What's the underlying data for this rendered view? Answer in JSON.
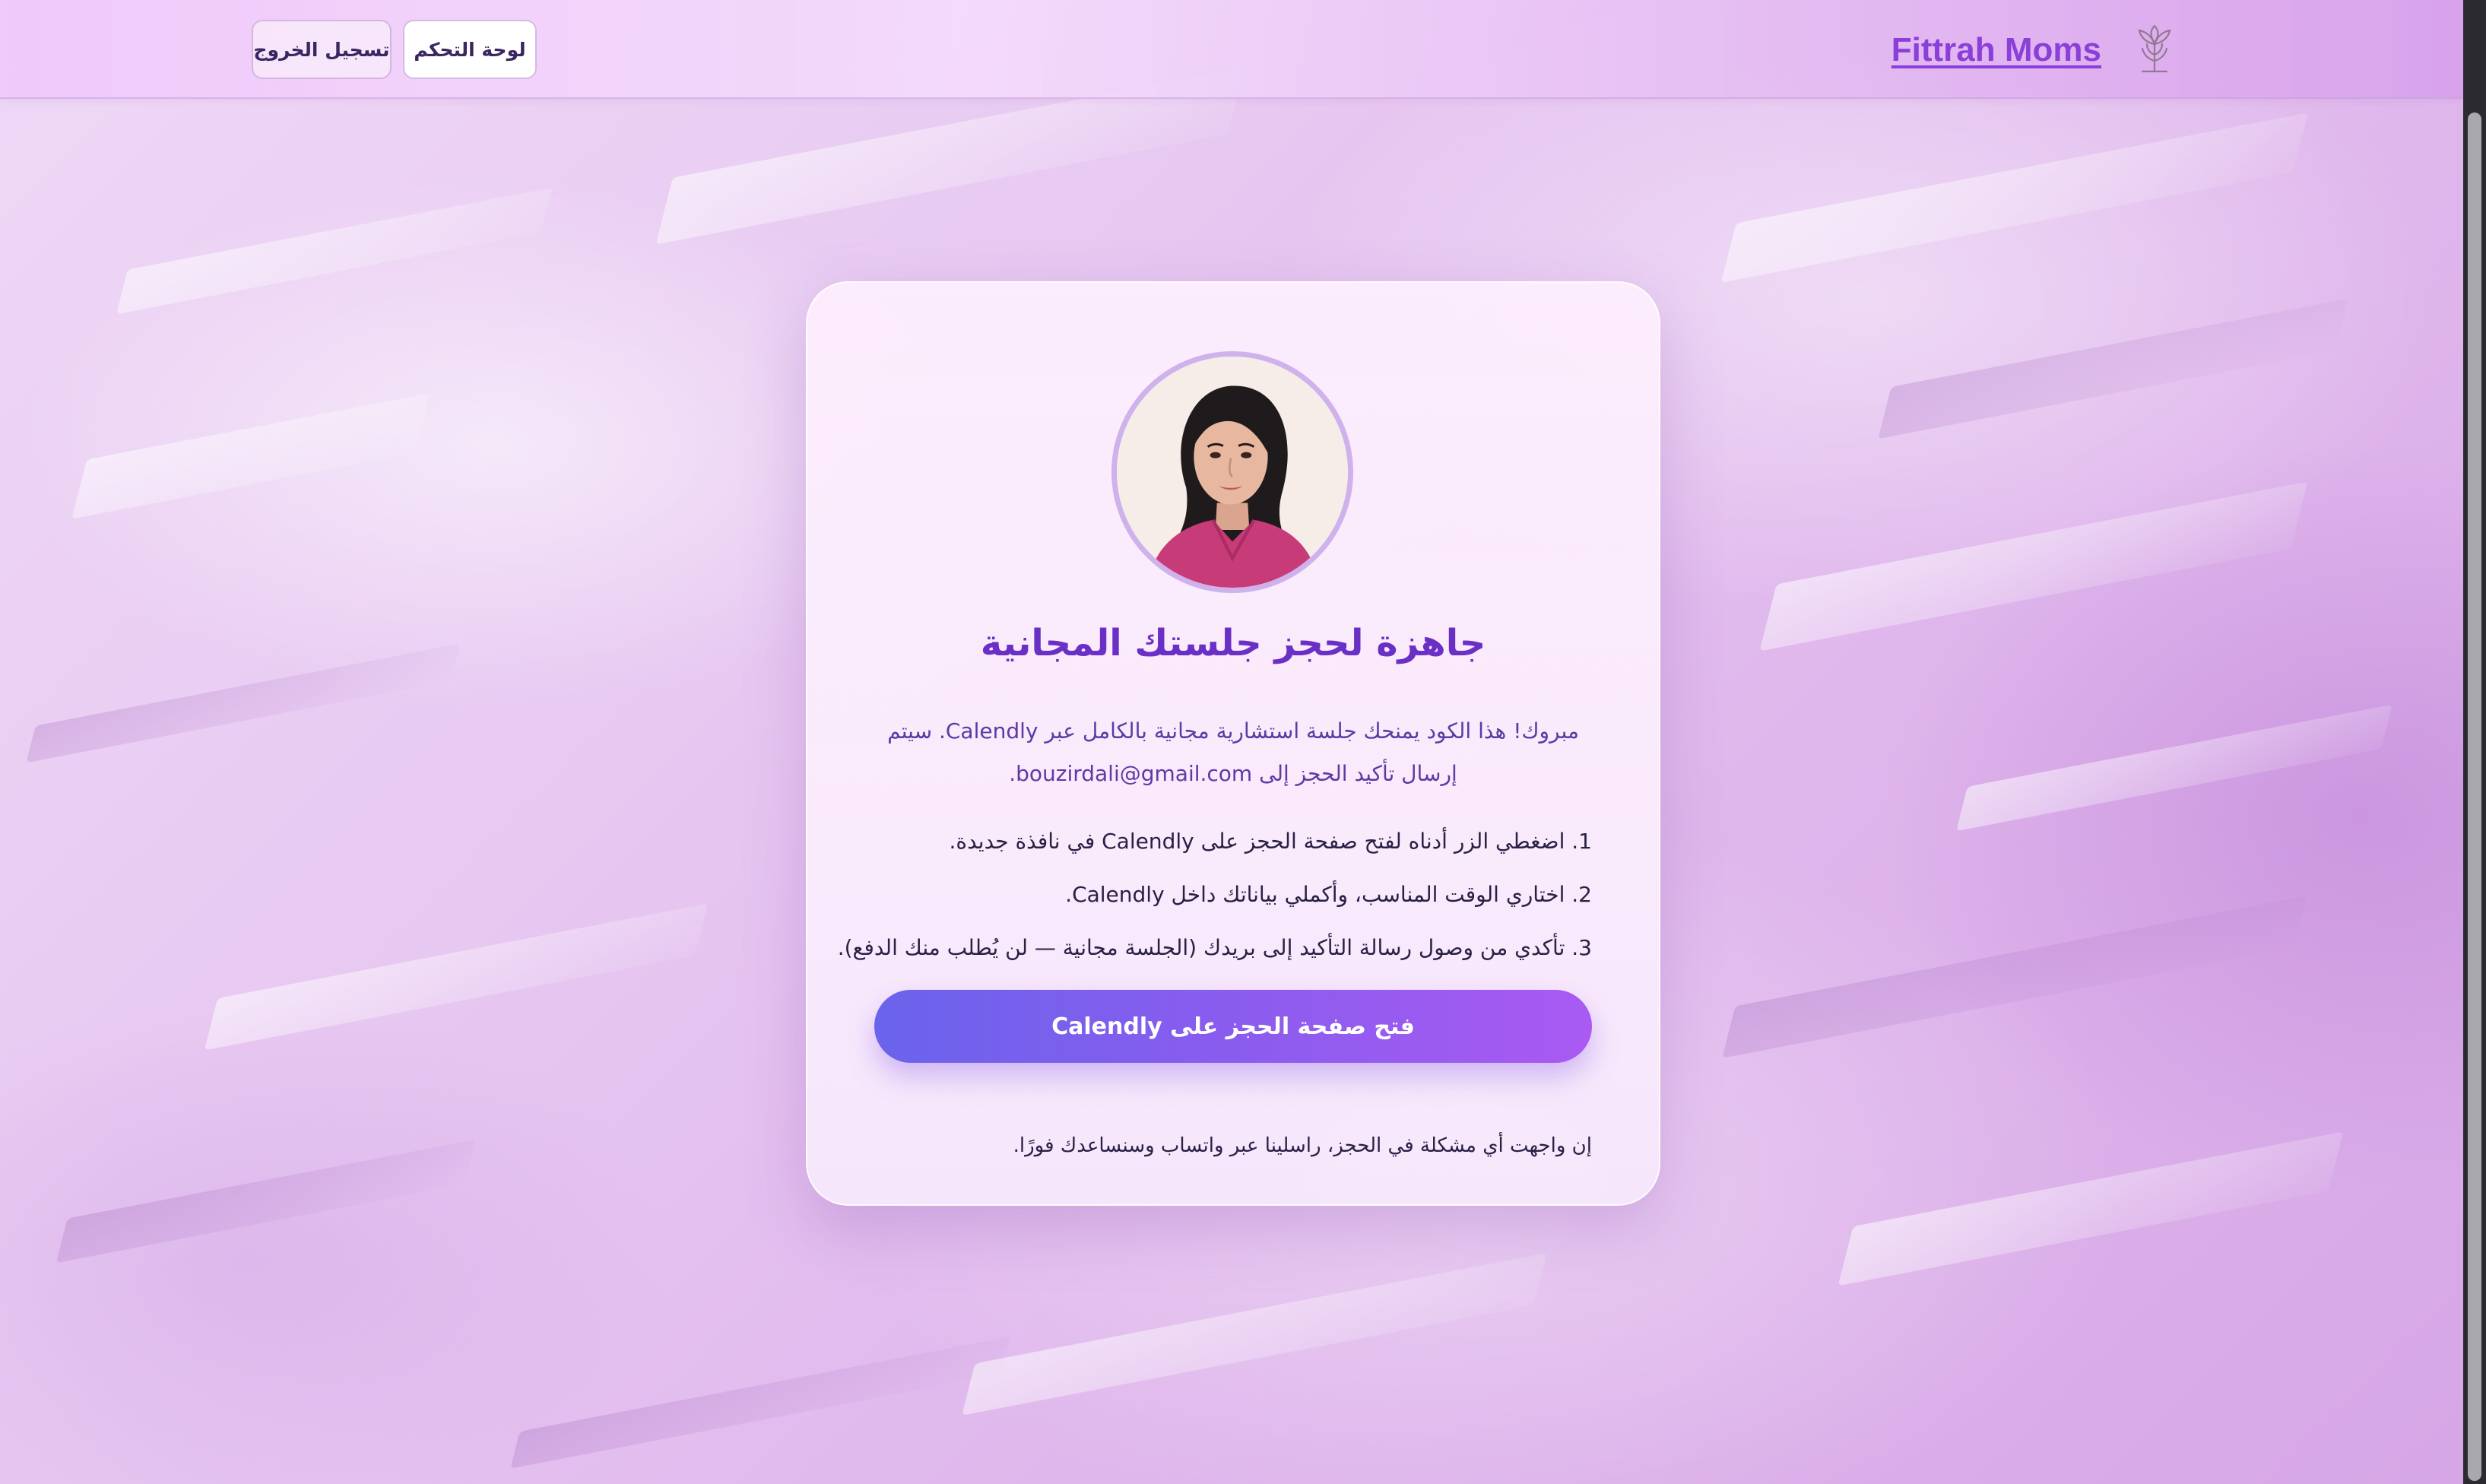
{
  "header": {
    "brand_name": "Fittrah Moms",
    "logo_icon": "lotus-tree-logo",
    "dashboard_label": "لوحة التحكم",
    "logout_label": "تسجيل الخروج"
  },
  "card": {
    "avatar": "consultant-portrait",
    "title": "جاهزة لحجز جلستك المجانية",
    "description": "مبروك! هذا الكود يمنحك جلسة استشارية مجانية بالكامل عبر Calendly. سيتم إرسال تأكيد الحجز إلى bouzirdali@gmail.com.",
    "steps": [
      "1. اضغطي الزر أدناه لفتح صفحة الحجز على Calendly في نافذة جديدة.",
      "2. اختاري الوقت المناسب، وأكملي بياناتك داخل Calendly.",
      "3. تأكدي من وصول رسالة التأكيد إلى بريدك (الجلسة مجانية — لن يُطلب منك الدفع)."
    ],
    "cta_label": "فتح صفحة الحجز على Calendly",
    "help_note": "إن واجهت أي مشكلة في الحجز، راسلينا عبر واتساب وسنساعدك فورًا."
  },
  "colors": {
    "accent": "#8a3fd8",
    "title": "#6a2fc4",
    "cta_start": "#6a63ec",
    "cta_end": "#a95af2"
  }
}
